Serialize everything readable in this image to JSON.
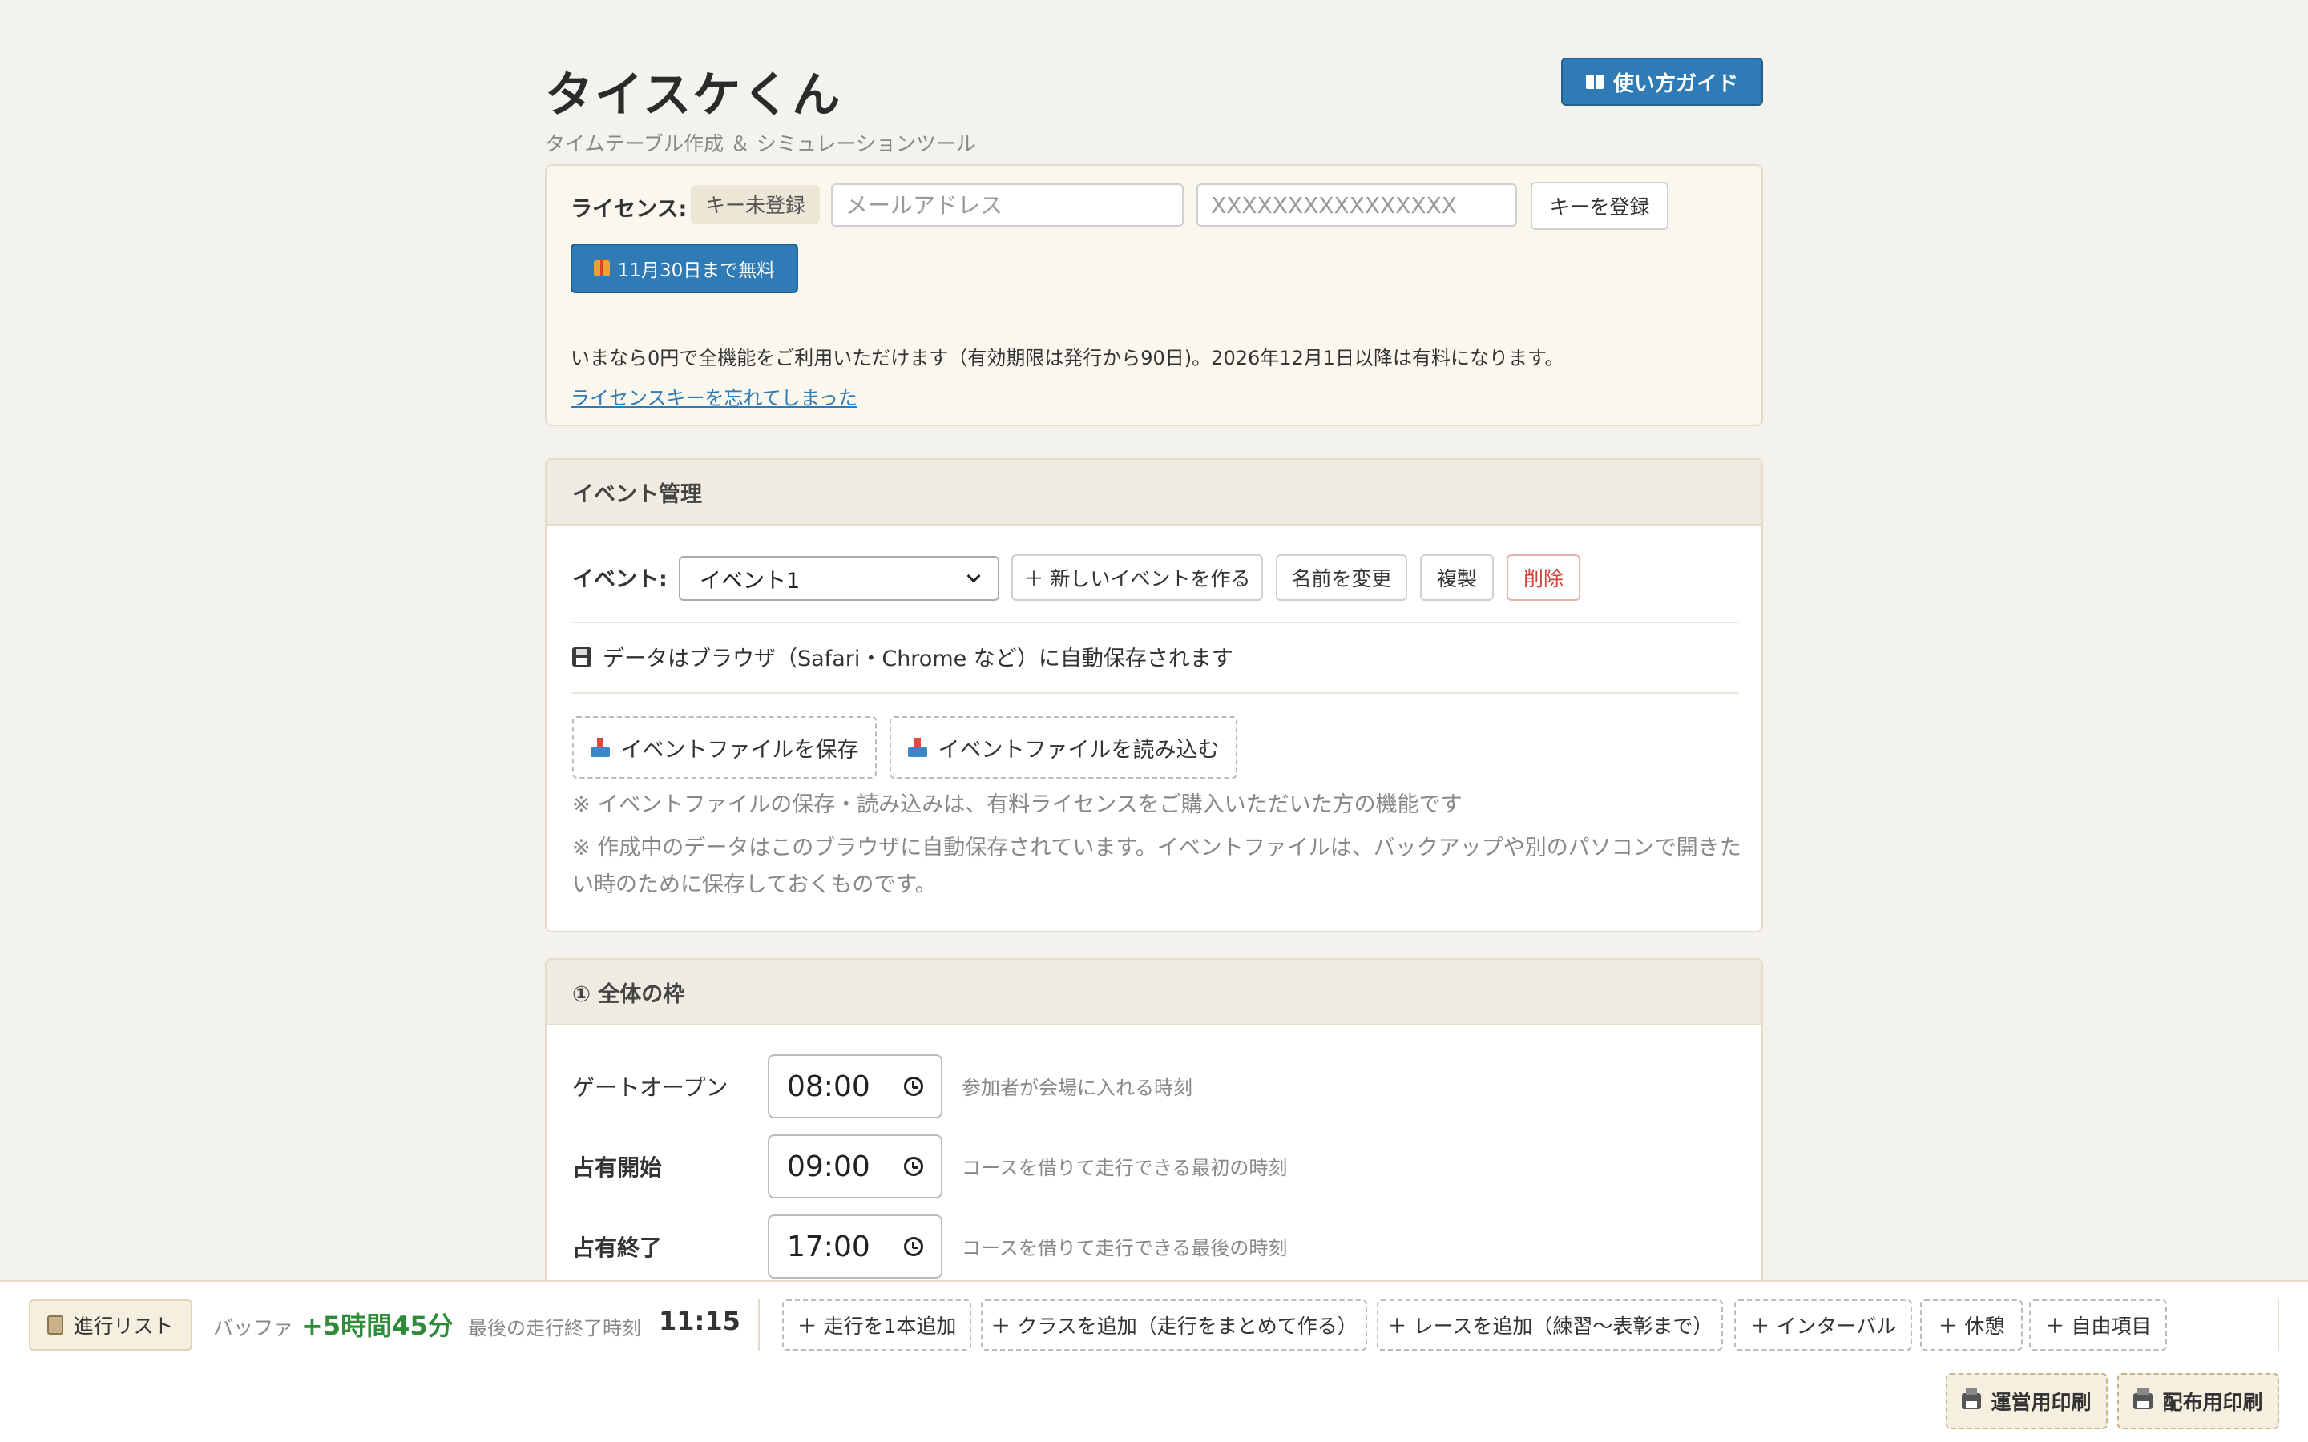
{
  "header": {
    "title": "タイスケくん",
    "subtitle": "タイムテーブル作成 ＆ シミュレーションツール",
    "guide_button": "使い方ガイド"
  },
  "license": {
    "label": "ライセンス:",
    "status_badge": "キー未登録",
    "email_placeholder": "メールアドレス",
    "key_placeholder": "XXXXXXXXXXXXXXXX",
    "register_button": "キーを登録",
    "free_button": "11月30日まで無料",
    "note": "いまなら0円で全機能をご利用いただけます（有効期限は発行から90日)。2026年12月1日以降は有料になります。",
    "forgot_link": "ライセンスキーを忘れてしまった"
  },
  "event_section": {
    "title": "イベント管理",
    "event_label": "イベント:",
    "selected_event": "イベント1",
    "new_button": "＋ 新しいイベントを作る",
    "rename_button": "名前を変更",
    "duplicate_button": "複製",
    "delete_button": "削除",
    "autosave_text": "データはブラウザ（Safari・Chrome など）に自動保存されます",
    "save_file_button": "イベントファイルを保存",
    "load_file_button": "イベントファイルを読み込む",
    "note1": "※ イベントファイルの保存・読み込みは、有料ライセンスをご購入いただいた方の機能です",
    "note2": "※ 作成中のデータはこのブラウザに自動保存されています。イベントファイルは、バックアップや別のパソコンで開きたい時のために保存しておくものです。"
  },
  "frame_section": {
    "title": "① 全体の枠",
    "rows": [
      {
        "label": "ゲートオープン",
        "time": "08:00",
        "desc": "参加者が会場に入れる時刻"
      },
      {
        "label": "占有開始",
        "time": "09:00",
        "desc": "コースを借りて走行できる最初の時刻"
      },
      {
        "label": "占有終了",
        "time": "17:00",
        "desc": "コースを借りて走行できる最後の時刻"
      }
    ]
  },
  "bottom_bar": {
    "progress_list": "進行リスト",
    "buffer_label": "バッファ",
    "buffer_value": "+5時間45分",
    "last_end_label": "最後の走行終了時刻",
    "last_end_value": "11:15",
    "add_buttons": [
      "＋ 走行を1本追加",
      "＋ クラスを追加（走行をまとめて作る）",
      "＋ レースを追加（練習〜表彰まで）",
      "＋ インターバル",
      "＋ 休憩",
      "＋ 自由項目"
    ],
    "print_ops": "運営用印刷",
    "print_dist": "配布用印刷"
  },
  "colors": {
    "accent": "#2e7bb5",
    "buffer_positive": "#2e8b3a",
    "danger": "#d0413d",
    "background": "#f4f2ec"
  }
}
